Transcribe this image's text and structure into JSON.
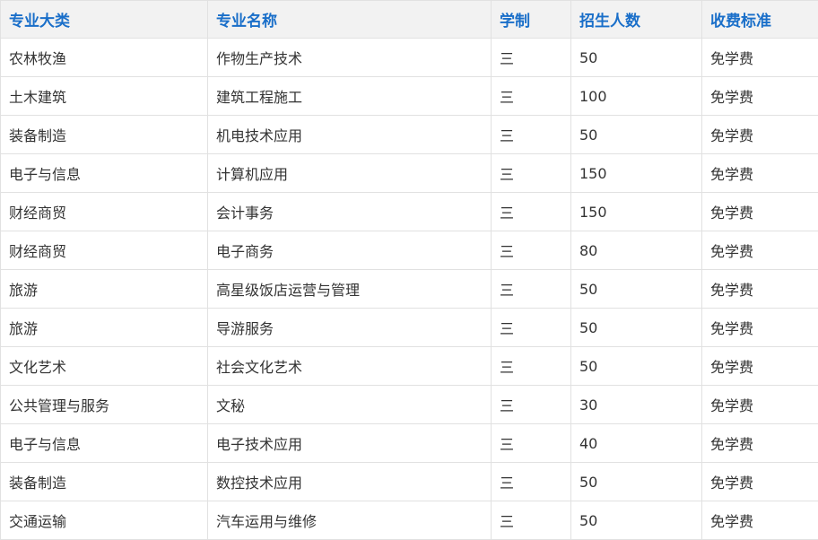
{
  "table": {
    "headers": [
      "专业大类",
      "专业名称",
      "学制",
      "招生人数",
      "收费标准"
    ],
    "rows": [
      [
        "农林牧渔",
        "作物生产技术",
        "三",
        "50",
        "免学费"
      ],
      [
        "土木建筑",
        "建筑工程施工",
        "三",
        "100",
        "免学费"
      ],
      [
        "装备制造",
        "机电技术应用",
        "三",
        "50",
        "免学费"
      ],
      [
        "电子与信息",
        "计算机应用",
        "三",
        "150",
        "免学费"
      ],
      [
        "财经商贸",
        "会计事务",
        "三",
        "150",
        "免学费"
      ],
      [
        "财经商贸",
        "电子商务",
        "三",
        "80",
        "免学费"
      ],
      [
        "旅游",
        "高星级饭店运营与管理",
        "三",
        "50",
        "免学费"
      ],
      [
        "旅游",
        "导游服务",
        "三",
        "50",
        "免学费"
      ],
      [
        "文化艺术",
        "社会文化艺术",
        "三",
        "50",
        "免学费"
      ],
      [
        "公共管理与服务",
        "文秘",
        "三",
        "30",
        "免学费"
      ],
      [
        "电子与信息",
        "电子技术应用",
        "三",
        "40",
        "免学费"
      ],
      [
        "装备制造",
        "数控技术应用",
        "三",
        "50",
        "免学费"
      ],
      [
        "交通运输",
        "汽车运用与维修",
        "三",
        "50",
        "免学费"
      ]
    ]
  },
  "colors": {
    "header_text": "#1a6fc9",
    "header_bg": "#f2f2f2",
    "border": "#e1e1e1",
    "body_text": "#333333"
  }
}
